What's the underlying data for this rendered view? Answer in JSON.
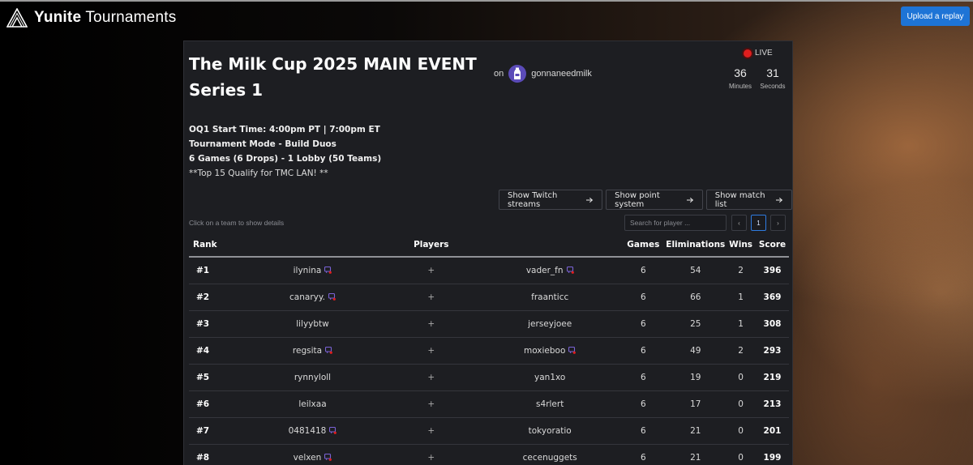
{
  "header": {
    "brand_bold": "Yunite",
    "brand_light": "Tournaments",
    "upload_label": "Upload a replay"
  },
  "event": {
    "title": "The Milk Cup 2025 MAIN EVENT Series 1",
    "host_prefix": "on",
    "host_name": "gonnaneedmilk",
    "live_label": "LIVE",
    "timer": {
      "minutes": "36",
      "minutes_label": "Minutes",
      "seconds": "31",
      "seconds_label": "Seconds"
    },
    "info_lines": [
      "OQ1 Start Time: 4:00pm PT | 7:00pm ET",
      "Tournament Mode - Build Duos",
      "6 Games (6 Drops) - 1 Lobby (50 Teams)",
      "**Top 15 Qualify for TMC LAN! **"
    ]
  },
  "actions": {
    "twitch": "Show Twitch streams",
    "points": "Show point system",
    "matches": "Show match list"
  },
  "hint": "Click on a team to show details",
  "search_placeholder": "Search for player ...",
  "pager": {
    "prev": "‹",
    "current": "1",
    "next": "›"
  },
  "table": {
    "headers": {
      "rank": "Rank",
      "players": "Players",
      "games": "Games",
      "eliminations": "Eliminations",
      "wins": "Wins",
      "score": "Score"
    },
    "rows": [
      {
        "rank": "#1",
        "p1": "ilynina",
        "p1_twitch": true,
        "plus": "+",
        "p2": "vader_fn",
        "p2_twitch": true,
        "games": "6",
        "elims": "54",
        "wins": "2",
        "score": "396"
      },
      {
        "rank": "#2",
        "p1": "canaryy.",
        "p1_twitch": true,
        "plus": "+",
        "p2": "fraanticc",
        "p2_twitch": false,
        "games": "6",
        "elims": "66",
        "wins": "1",
        "score": "369"
      },
      {
        "rank": "#3",
        "p1": "lilyybtw",
        "p1_twitch": false,
        "plus": "+",
        "p2": "jerseyjoee",
        "p2_twitch": false,
        "games": "6",
        "elims": "25",
        "wins": "1",
        "score": "308"
      },
      {
        "rank": "#4",
        "p1": "regsita",
        "p1_twitch": true,
        "plus": "+",
        "p2": "moxieboo",
        "p2_twitch": true,
        "games": "6",
        "elims": "49",
        "wins": "2",
        "score": "293"
      },
      {
        "rank": "#5",
        "p1": "rynnyloll",
        "p1_twitch": false,
        "plus": "+",
        "p2": "yan1xo",
        "p2_twitch": false,
        "games": "6",
        "elims": "19",
        "wins": "0",
        "score": "219"
      },
      {
        "rank": "#6",
        "p1": "leilxaa",
        "p1_twitch": false,
        "plus": "+",
        "p2": "s4rlert",
        "p2_twitch": false,
        "games": "6",
        "elims": "17",
        "wins": "0",
        "score": "213"
      },
      {
        "rank": "#7",
        "p1": "0481418",
        "p1_twitch": true,
        "plus": "+",
        "p2": "tokyoratio",
        "p2_twitch": false,
        "games": "6",
        "elims": "21",
        "wins": "0",
        "score": "201"
      },
      {
        "rank": "#8",
        "p1": "velxen",
        "p1_twitch": true,
        "plus": "+",
        "p2": "cecenuggets",
        "p2_twitch": false,
        "games": "6",
        "elims": "21",
        "wins": "0",
        "score": "199"
      }
    ]
  },
  "colors": {
    "accent": "#1e74d6",
    "panel": "#1d1e22",
    "live": "#e01e1e",
    "twitch": "#7b63d6"
  }
}
